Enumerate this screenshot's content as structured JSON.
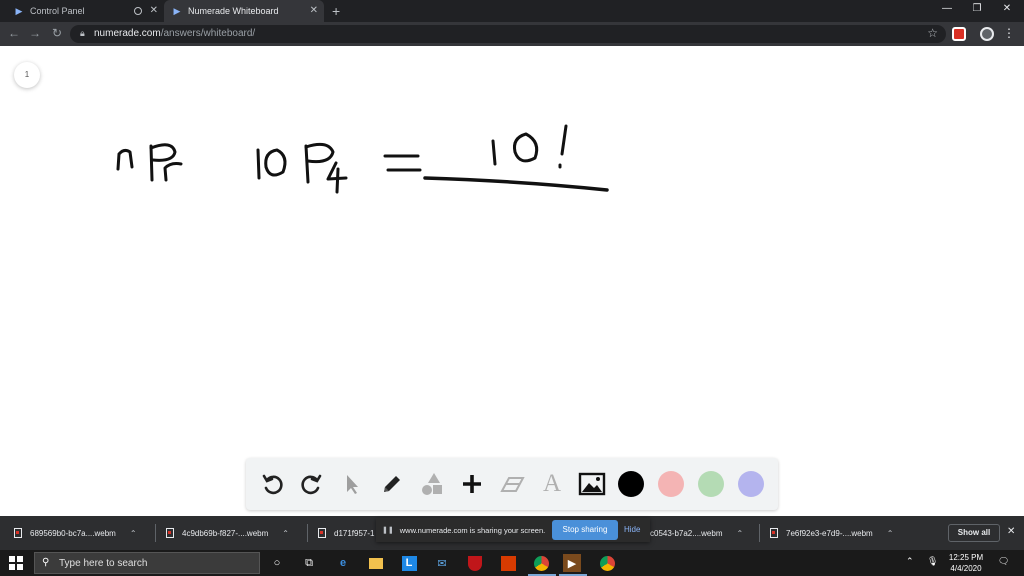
{
  "browser": {
    "tabs": [
      {
        "title": "Control Panel"
      },
      {
        "title": "Numerade Whiteboard"
      }
    ],
    "url_host": "numerade.com",
    "url_path": "/answers/whiteboard/"
  },
  "whiteboard": {
    "page_number": "1",
    "handwriting": "nPr   10P4 = 10!",
    "tools": [
      "undo-icon",
      "redo-icon",
      "pointer-icon",
      "pencil-icon",
      "shapes-icon",
      "plus-icon",
      "eraser-icon",
      "text-icon",
      "image-icon"
    ],
    "text_tool_glyph": "A",
    "colors": [
      "#000000",
      "#f4b4b4",
      "#b4dbb4",
      "#b4b4ee"
    ]
  },
  "downloads": {
    "items": [
      "689569b0-bc7a....webm",
      "4c9db69b-f827-....webm",
      "d171f957-1",
      "c0543-b7a2....webm",
      "7e6f92e3-e7d9-....webm"
    ],
    "show_all": "Show all"
  },
  "share_bar": {
    "message": "www.numerade.com is sharing your screen.",
    "stop_label": "Stop sharing",
    "hide_label": "Hide"
  },
  "taskbar": {
    "search_placeholder": "Type here to search",
    "time": "12:25 PM",
    "date": "4/4/2020"
  }
}
